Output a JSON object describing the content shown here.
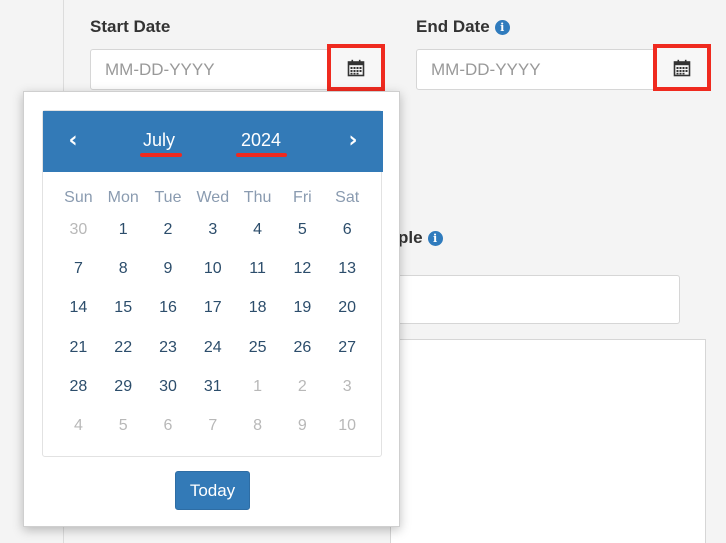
{
  "start_date": {
    "label": "Start Date",
    "placeholder": "MM-DD-YYYY"
  },
  "end_date": {
    "label": "End Date",
    "placeholder": "MM-DD-YYYY"
  },
  "people": {
    "label_partial": "ple"
  },
  "calendar": {
    "month": "July",
    "year": "2024",
    "prev": "‹",
    "next": "›",
    "weekdays": [
      "Sun",
      "Mon",
      "Tue",
      "Wed",
      "Thu",
      "Fri",
      "Sat"
    ],
    "weeks": [
      [
        {
          "d": "30",
          "m": true
        },
        {
          "d": "1"
        },
        {
          "d": "2"
        },
        {
          "d": "3"
        },
        {
          "d": "4"
        },
        {
          "d": "5"
        },
        {
          "d": "6"
        }
      ],
      [
        {
          "d": "7"
        },
        {
          "d": "8"
        },
        {
          "d": "9"
        },
        {
          "d": "10"
        },
        {
          "d": "11"
        },
        {
          "d": "12"
        },
        {
          "d": "13"
        }
      ],
      [
        {
          "d": "14"
        },
        {
          "d": "15"
        },
        {
          "d": "16"
        },
        {
          "d": "17"
        },
        {
          "d": "18"
        },
        {
          "d": "19"
        },
        {
          "d": "20"
        }
      ],
      [
        {
          "d": "21"
        },
        {
          "d": "22"
        },
        {
          "d": "23"
        },
        {
          "d": "24"
        },
        {
          "d": "25"
        },
        {
          "d": "26"
        },
        {
          "d": "27"
        }
      ],
      [
        {
          "d": "28"
        },
        {
          "d": "29"
        },
        {
          "d": "30"
        },
        {
          "d": "31"
        },
        {
          "d": "1",
          "m": true
        },
        {
          "d": "2",
          "m": true
        },
        {
          "d": "3",
          "m": true
        }
      ],
      [
        {
          "d": "4",
          "m": true
        },
        {
          "d": "5",
          "m": true
        },
        {
          "d": "6",
          "m": true
        },
        {
          "d": "7",
          "m": true
        },
        {
          "d": "8",
          "m": true
        },
        {
          "d": "9",
          "m": true
        },
        {
          "d": "10",
          "m": true
        }
      ]
    ],
    "today_label": "Today"
  },
  "colors": {
    "accent": "#337ab7",
    "highlight": "#ef2a1f"
  }
}
